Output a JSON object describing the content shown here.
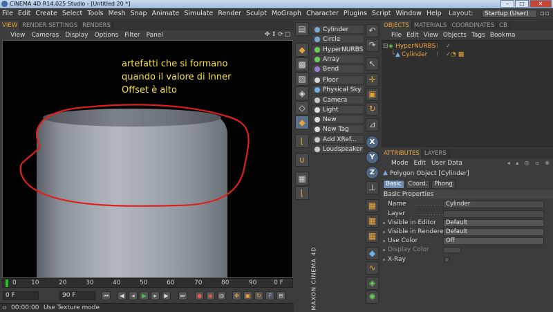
{
  "window": {
    "title": "CINEMA 4D R14.025 Studio - [Untitled 20 *]",
    "buttons": [
      "–",
      "□",
      "✕"
    ]
  },
  "menubar": {
    "items": [
      "File",
      "Edit",
      "Create",
      "Select",
      "Tools",
      "Mesh",
      "Snap",
      "Animate",
      "Simulate",
      "Render",
      "Sculpt",
      "MoGraph",
      "Character",
      "Plugins",
      "Script",
      "Window",
      "Help"
    ],
    "layout_label": "Layout:",
    "layout_value": "Startup (User)"
  },
  "viewport": {
    "tabs": [
      "VIEW",
      "RENDER SETTINGS",
      "RENDERS"
    ],
    "menu": [
      "View",
      "Cameras",
      "Display",
      "Options",
      "Filter",
      "Panel"
    ],
    "annotation": "artefatti che si formano quando il valore di Inner Offset è alto"
  },
  "timeline": {
    "labels": [
      "0",
      "10",
      "20",
      "30",
      "40",
      "50",
      "60",
      "70",
      "80",
      "90"
    ],
    "overflow_label": "0 F",
    "start_field": "0 F",
    "end_field": "90 F",
    "current_field": "0 F"
  },
  "status": {
    "time": "00:00:00",
    "message": "Use Texture mode"
  },
  "maxon": "MAXON CINEMA 4D",
  "palette": {
    "items": [
      {
        "label": "Cylinder",
        "color": "#7aa8d8"
      },
      {
        "label": "Circle",
        "color": "#7aa8d8"
      },
      {
        "label": "HyperNURBS",
        "color": "#6ccf5a"
      },
      {
        "label": "Array",
        "color": "#6ccf5a"
      },
      {
        "label": "Bend",
        "color": "#9a7fd8"
      },
      {
        "label": "Floor",
        "color": "#d8d8d8"
      },
      {
        "label": "Physical Sky",
        "color": "#6fb0e8"
      },
      {
        "label": "Camera",
        "color": "#cccccc"
      },
      {
        "label": "Light",
        "color": "#dddddd"
      },
      {
        "label": "New Material",
        "color": "#e0e0e0"
      },
      {
        "label": "New Tag",
        "color": "#e0e0e0"
      },
      {
        "label": "Add XRef...",
        "color": "#cccccc"
      },
      {
        "label": "Loudspeaker",
        "color": "#cccccc"
      }
    ]
  },
  "objects_panel": {
    "tabs": [
      "OBJECTS",
      "MATERIALS",
      "COORDINATES",
      "CB"
    ],
    "menu": [
      "File",
      "Edit",
      "View",
      "Objects",
      "Tags",
      "Bookma"
    ],
    "rows": [
      {
        "name": "HyperNURBS",
        "flags": "⁝ ✓"
      },
      {
        "name": "Cylinder",
        "flags": "⁝ ✓"
      }
    ]
  },
  "attributes_panel": {
    "tabs": [
      "ATTRIBUTES",
      "LAYERS"
    ],
    "menu": [
      "Mode",
      "Edit",
      "User Data"
    ],
    "object_label": "Polygon Object [Cylinder]",
    "subtabs": [
      "Basic",
      "Coord.",
      "Phong"
    ],
    "section": "Basic Properties",
    "properties": [
      {
        "label": "Name",
        "value": "Cylinder"
      },
      {
        "label": "Layer",
        "value": ""
      },
      {
        "label": "Visible in Editor",
        "value": "Default"
      },
      {
        "label": "Visible in Renderer",
        "value": "Default"
      },
      {
        "label": "Use Color",
        "value": "Off"
      },
      {
        "label": "Display Color",
        "value": ""
      },
      {
        "label": "X-Ray",
        "value": ""
      }
    ]
  },
  "colors": {
    "accent": "#e8a23b",
    "annotation": "#f5e042",
    "loop": "#e0201c"
  }
}
